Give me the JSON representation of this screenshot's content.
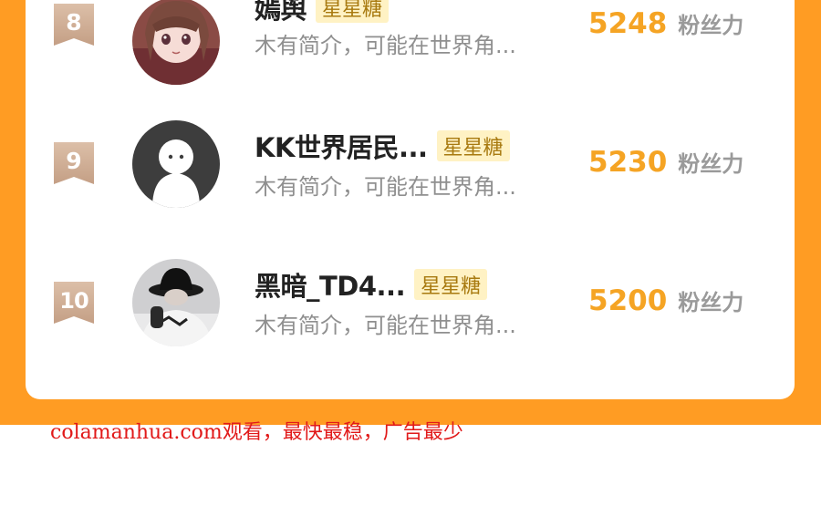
{
  "leaderboard": {
    "entries": [
      {
        "rank": "8",
        "name": "嫣舆",
        "tag": "星星糖",
        "intro": "木有简介，可能在世界角...",
        "score": "5248",
        "unit": "粉丝力",
        "avatar": "anime-girl-avatar-icon"
      },
      {
        "rank": "9",
        "name": "KK世界居民...",
        "tag": "星星糖",
        "intro": "木有简介，可能在世界角...",
        "score": "5230",
        "unit": "粉丝力",
        "avatar": "default-ghost-avatar-icon"
      },
      {
        "rank": "10",
        "name": "黑暗_TD4...",
        "tag": "星星糖",
        "intro": "木有简介，可能在世界角...",
        "score": "5200",
        "unit": "粉丝力",
        "avatar": "bucket-hat-photo-avatar-icon"
      }
    ]
  },
  "watermark": {
    "text": "colamanhua.com观看，最快最稳，广告最少"
  },
  "colors": {
    "frame": "#ff9c23",
    "score": "#f5a424",
    "tag_bg": "#fff2c4",
    "badge": "#d2ae92",
    "watermark": "#e11a1a"
  }
}
